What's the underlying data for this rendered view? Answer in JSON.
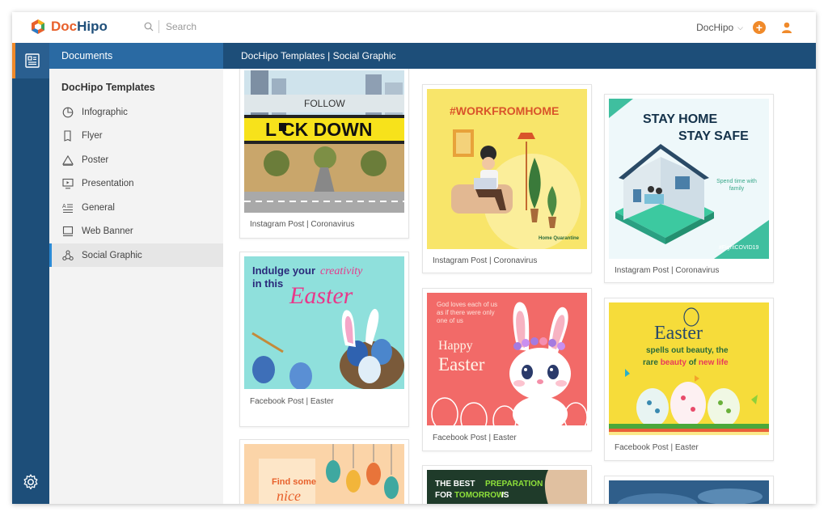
{
  "app": {
    "brand_part1": "Doc",
    "brand_part2": "Hipo"
  },
  "topbar": {
    "search_placeholder": "Search",
    "account_label": "DocHipo",
    "plus_label": "+"
  },
  "header": {
    "documents_label": "Documents",
    "breadcrumb": "DocHipo Templates | Social Graphic"
  },
  "sidebar": {
    "title": "DocHipo Templates",
    "items": [
      {
        "label": "Infographic",
        "icon": "pie-chart-icon"
      },
      {
        "label": "Flyer",
        "icon": "flyer-icon"
      },
      {
        "label": "Poster",
        "icon": "poster-icon"
      },
      {
        "label": "Presentation",
        "icon": "presentation-icon"
      },
      {
        "label": "General",
        "icon": "general-icon"
      },
      {
        "label": "Web Banner",
        "icon": "web-banner-icon"
      },
      {
        "label": "Social Graphic",
        "icon": "social-graphic-icon",
        "active": true
      }
    ]
  },
  "cards": {
    "lockdown": {
      "caption": "Instagram Post | Coronavirus",
      "line1": "FOLLOW",
      "line2": "L CK DOWN"
    },
    "wfh": {
      "caption": "Instagram Post | Coronavirus",
      "headline": "#WORKFROMHOME",
      "note": "Home Quarantine"
    },
    "stayhome": {
      "caption": "Instagram Post | Coronavirus",
      "line1": "STAY HOME",
      "line2": "STAY SAFE",
      "sub": "Spend time with family",
      "tag": "#FightCOVID19"
    },
    "indulge": {
      "caption": "Facebook Post | Easter",
      "line1a": "Indulge your",
      "line1b": "creativity",
      "line2a": "in this",
      "line2b": "Easter"
    },
    "bunny": {
      "caption": "Facebook Post | Easter",
      "verse": "God loves each of us as if there were only one of us",
      "happy": "Happy",
      "easter": "Easter"
    },
    "eastergreen": {
      "caption": "Facebook Post | Easter",
      "title": "Easter",
      "sub1": "spells out beauty, the",
      "sub2a": "rare ",
      "sub2b": "beauty",
      "sub2c": " of ",
      "sub2d": "new life"
    },
    "findsome": {
      "line1": "Find some",
      "line2": "nice"
    },
    "preparation": {
      "line1a": "THE BEST ",
      "line1b": "PREPARATION",
      "line2a": "FOR ",
      "line2b": "TOMORROW",
      "line2c": " IS"
    }
  },
  "colors": {
    "brand_orange": "#e8612c",
    "brand_navy": "#1d4e79",
    "active_blue": "#2a6aa3",
    "accent_orange": "#f08a2a"
  }
}
